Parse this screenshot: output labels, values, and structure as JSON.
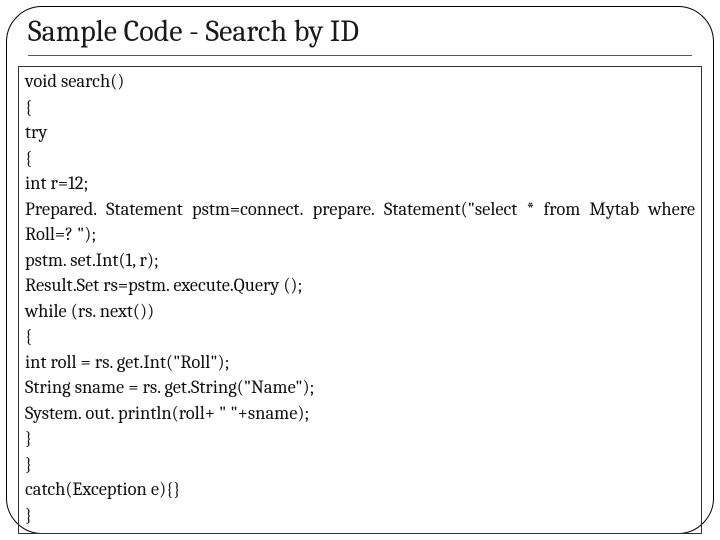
{
  "slide": {
    "title": "Sample Code - Search by ID",
    "code": {
      "l0": "void search()",
      "l1": "{",
      "l2": "try",
      "l3": "{",
      "l4": "int r=12;",
      "j5": {
        "w0": "Prepared.",
        "w1": "Statement",
        "w2": "pstm=connect.",
        "w3": "prepare.",
        "w4": "Statement(\"select",
        "w5": "*",
        "w6": "from",
        "w7": "Mytab",
        "w8": "where"
      },
      "l6": "Roll=? \");",
      "l7": "pstm. set.Int(1, r);",
      "l8": "Result.Set rs=pstm. execute.Query ();",
      "l9": "while (rs. next())",
      "l10": "{",
      "l11": "int roll = rs. get.Int(\"Roll\");",
      "l12": "String sname = rs. get.String(\"Name\");",
      "l13": "System. out. println(roll+ \" \"+sname);",
      "l14": "}",
      "l15": "}",
      "l16": "catch(Exception e){}",
      "l17": "}"
    }
  }
}
